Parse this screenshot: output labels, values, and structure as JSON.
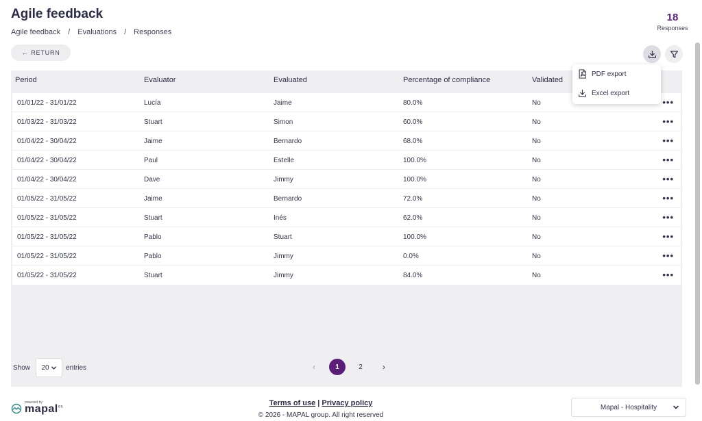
{
  "header": {
    "title": "Agile feedback",
    "breadcrumb": [
      "Agile feedback",
      "Evaluations",
      "Responses"
    ],
    "count_value": "18",
    "count_label": "Responses",
    "return_label": "RETURN",
    "return_arrow": "←"
  },
  "icons": {
    "download": "download-icon",
    "filter": "filter-icon",
    "pdf": "pdf-file-icon",
    "excel": "download-icon",
    "more": "ellipsis-icon",
    "chevron": "chevron-down-icon"
  },
  "export_menu": {
    "pdf_label": "PDF export",
    "excel_label": "Excel export"
  },
  "table": {
    "columns": [
      "Period",
      "Evaluator",
      "Evaluated",
      "Percentage of compliance",
      "Validated"
    ],
    "rows": [
      [
        "01/01/22 - 31/01/22",
        "Lucía",
        "Jaime",
        "80.0%",
        "No"
      ],
      [
        "01/03/22 - 31/03/22",
        "Stuart",
        "Simon",
        "60.0%",
        "No"
      ],
      [
        "01/04/22 - 30/04/22",
        "Jaime",
        "Bernardo",
        "68.0%",
        "No"
      ],
      [
        "01/04/22 - 30/04/22",
        "Paul",
        "Estelle",
        "100.0%",
        "No"
      ],
      [
        "01/04/22 - 30/04/22",
        "Dave",
        "Jimmy",
        "100.0%",
        "No"
      ],
      [
        "01/05/22 - 31/05/22",
        "Jaime",
        "Bernardo",
        "72.0%",
        "No"
      ],
      [
        "01/05/22 - 31/05/22",
        "Stuart",
        "Inés",
        "62.0%",
        "No"
      ],
      [
        "01/05/22 - 31/05/22",
        "Pablo",
        "Stuart",
        "100.0%",
        "No"
      ],
      [
        "01/05/22 - 31/05/22",
        "Pablo",
        "Jimmy",
        "0.0%",
        "No"
      ],
      [
        "01/05/22 - 31/05/22",
        "Stuart",
        "Jimmy",
        "84.0%",
        "No"
      ]
    ],
    "more_glyph": "•••"
  },
  "pagination": {
    "show_label": "Show",
    "entries_value": "20",
    "entries_label": "entries",
    "prev": "‹",
    "next": "›",
    "pages": [
      "1",
      "2"
    ],
    "active_page": "1"
  },
  "footer": {
    "powered_by": "powered by",
    "brand": "mapal",
    "brand_suffix": "os",
    "terms": "Terms of use",
    "divider": "|",
    "privacy": "Privacy policy",
    "copyright": "© 2026 - MAPAL group. All right reserved",
    "org_value": "Mapal - Hospitality"
  },
  "colors": {
    "accent": "#5a1e78",
    "panel_bg": "#efeff2",
    "text": "#33334d"
  }
}
